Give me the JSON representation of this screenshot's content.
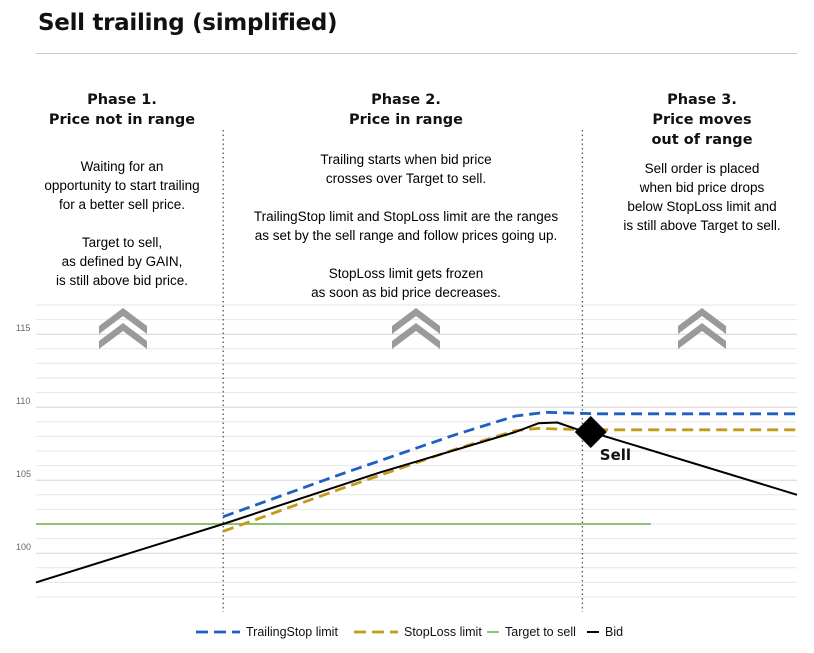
{
  "title": "Sell trailing (simplified)",
  "phases": [
    {
      "title_lines": [
        "Phase 1.",
        "Price not in range"
      ],
      "paragraphs": [
        [
          "Waiting for an",
          "opportunity to start trailing",
          "for a better sell price."
        ],
        [
          "Target to sell,",
          "as defined by GAIN,",
          "is still above bid price."
        ]
      ]
    },
    {
      "title_lines": [
        "Phase 2.",
        "Price in range"
      ],
      "paragraphs": [
        [
          "Trailing starts when bid price",
          "crosses over Target to sell."
        ],
        [
          "TrailingStop limit and StopLoss limit are the ranges",
          "as set by the sell range and follow prices going up."
        ],
        [
          "StopLoss limit gets frozen",
          "as soon as bid price decreases."
        ]
      ]
    },
    {
      "title_lines": [
        "Phase 3.",
        "Price moves",
        "out of range"
      ],
      "paragraphs": [
        [
          "Sell order is placed",
          "when bid price drops",
          "below StopLoss limit and",
          "is still above Target to sell."
        ]
      ]
    }
  ],
  "colors": {
    "trailing": "#1f5fc4",
    "stoploss": "#c49a1a",
    "target": "#8dc473",
    "bid": "#000000",
    "chevron": "#9a9a9a",
    "gridline": "#e6e6e6",
    "divider": "#555555"
  },
  "chart_data": {
    "type": "line",
    "xlim": [
      0,
      100
    ],
    "ylim": [
      97,
      117
    ],
    "yticks": [
      100,
      105,
      110,
      115
    ],
    "grid": true,
    "phase_boundaries_x": [
      24.6,
      71.8
    ],
    "series": [
      {
        "name": "TrailingStop limit",
        "style": "dashed",
        "x": [
          24.6,
          40,
          55,
          63,
          67,
          70,
          74,
          80,
          100
        ],
        "y": [
          102.5,
          105.4,
          108.1,
          109.4,
          109.65,
          109.6,
          109.55,
          109.55,
          109.55
        ]
      },
      {
        "name": "StopLoss limit",
        "style": "dashed",
        "x": [
          24.6,
          40,
          55,
          63,
          66,
          69,
          73,
          80,
          100
        ],
        "y": [
          101.5,
          104.4,
          107.1,
          108.4,
          108.55,
          108.5,
          108.45,
          108.45,
          108.45
        ]
      },
      {
        "name": "Target to sell",
        "style": "solid",
        "x": [
          0,
          80.8
        ],
        "y": [
          102,
          102
        ]
      },
      {
        "name": "Bid",
        "style": "solid",
        "x": [
          0,
          24.6,
          45,
          63,
          66,
          68.5,
          71,
          72.9,
          100
        ],
        "y": [
          98,
          102,
          105.5,
          108.3,
          108.9,
          108.95,
          108.5,
          108.3,
          104
        ]
      }
    ],
    "annotations": [
      {
        "label": "Sell",
        "x": 72.9,
        "y": 108.3
      }
    ]
  }
}
